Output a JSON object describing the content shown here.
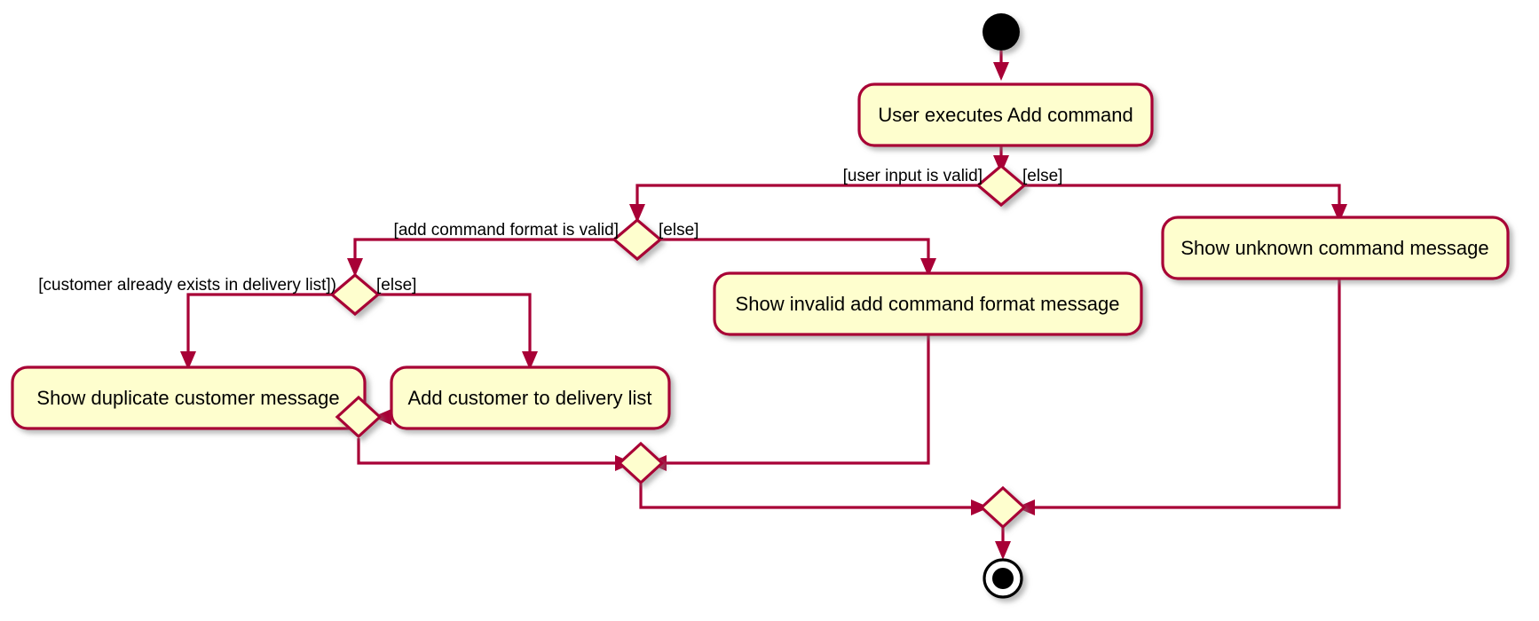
{
  "diagram": {
    "kind": "uml-activity-diagram",
    "background_color": "#FFFFFF",
    "colors": {
      "node_fill": "#FEFECE",
      "node_border": "#A80036",
      "edge": "#A80036",
      "terminal": "#000000",
      "text": "#000000",
      "shadow": "#808080"
    },
    "nodes": {
      "start": {
        "type": "initial-node",
        "label": ""
      },
      "activity_user_executes": {
        "type": "activity",
        "label": "User executes Add command"
      },
      "activity_show_unknown": {
        "type": "activity",
        "label": "Show unknown command message"
      },
      "activity_show_invalid_format": {
        "type": "activity",
        "label": "Show invalid add command format message"
      },
      "activity_show_duplicate": {
        "type": "activity",
        "label": "Show duplicate customer message"
      },
      "activity_add_customer": {
        "type": "activity",
        "label": "Add customer to delivery list"
      },
      "decision_user_input": {
        "type": "decision",
        "label": ""
      },
      "decision_command_format": {
        "type": "decision",
        "label": ""
      },
      "decision_duplicate": {
        "type": "decision",
        "label": ""
      },
      "merge_inner": {
        "type": "merge",
        "label": ""
      },
      "merge_middle": {
        "type": "merge",
        "label": ""
      },
      "merge_outer": {
        "type": "merge",
        "label": ""
      },
      "end": {
        "type": "final-node",
        "label": ""
      }
    },
    "guards": {
      "user_input_valid": "[user input is valid]",
      "user_input_else": "[else]",
      "add_format_valid": "[add command format is valid]",
      "add_format_else": "[else]",
      "customer_exists": "[customer already exists in delivery list])",
      "customer_exists_else": "[else]"
    }
  }
}
